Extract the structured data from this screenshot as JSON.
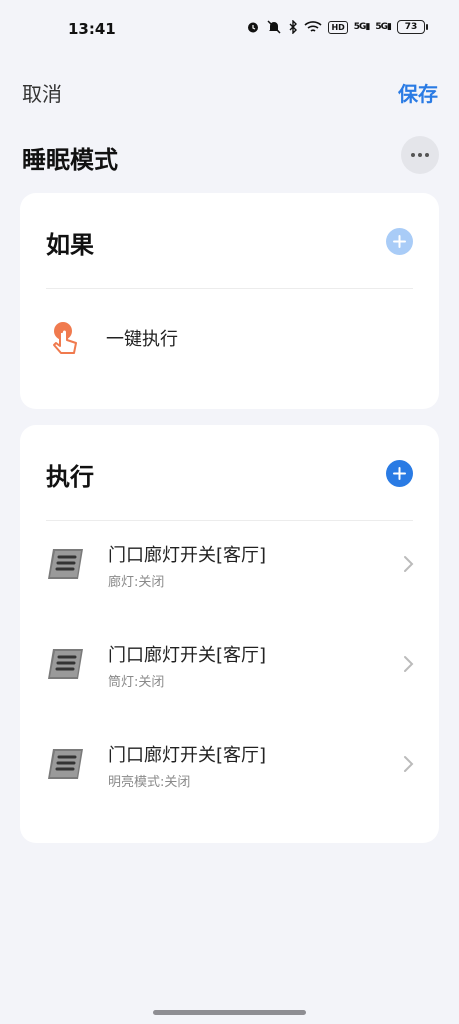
{
  "status_bar": {
    "time": "13:41",
    "battery": "73",
    "hd_label": "HD",
    "signal1": "5G",
    "signal2": "5G"
  },
  "topbar": {
    "cancel_label": "取消",
    "save_label": "保存"
  },
  "page": {
    "title": "睡眠模式"
  },
  "if_section": {
    "title": "如果",
    "trigger": {
      "label": "一键执行",
      "icon": "tap-hand-icon"
    }
  },
  "do_section": {
    "title": "执行",
    "actions": [
      {
        "name": "门口廊灯开关[客厅]",
        "detail": "廊灯:关闭",
        "icon": "switch-panel-icon"
      },
      {
        "name": "门口廊灯开关[客厅]",
        "detail": "筒灯:关闭",
        "icon": "switch-panel-icon"
      },
      {
        "name": "门口廊灯开关[客厅]",
        "detail": "明亮模式:关闭",
        "icon": "switch-panel-icon"
      }
    ]
  },
  "colors": {
    "accent": "#2a7be4",
    "accent_light": "#a9ccf7",
    "background": "#f3f4f9",
    "card": "#ffffff",
    "trigger_orange": "#f07a4e"
  }
}
